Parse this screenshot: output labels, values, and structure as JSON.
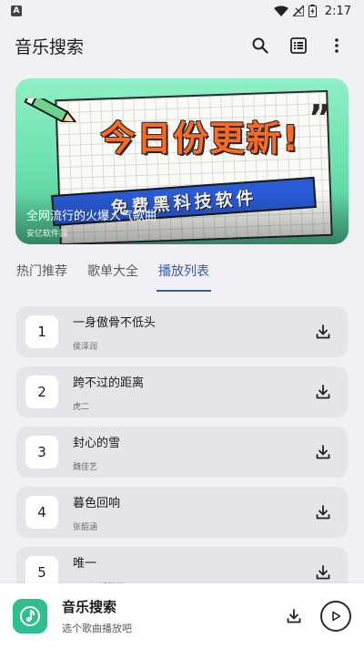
{
  "status_bar": {
    "notif_letter": "A",
    "time": "2:17"
  },
  "app_bar": {
    "title": "音乐搜索",
    "icons": [
      "search-icon",
      "list-icon",
      "more-vert-icon"
    ]
  },
  "banner": {
    "headline": "今日份更新!",
    "ribbon": "免费黑科技软件",
    "title": "全网流行的火爆人气歌曲",
    "source": "安亿软件园"
  },
  "tabs": [
    {
      "label": "热门推荐",
      "active": false
    },
    {
      "label": "歌单大全",
      "active": false
    },
    {
      "label": "播放列表",
      "active": true
    }
  ],
  "songs": [
    {
      "index": "1",
      "title": "一身傲骨不低头",
      "artist": "侯泽润"
    },
    {
      "index": "2",
      "title": "跨不过的距离",
      "artist": "虎二"
    },
    {
      "index": "3",
      "title": "封心的雪",
      "artist": "魏佳艺"
    },
    {
      "index": "4",
      "title": "暮色回响",
      "artist": "张韶涵"
    },
    {
      "index": "5",
      "title": "唯一",
      "artist": "G.E.M.邓紫棋"
    }
  ],
  "player": {
    "title": "音乐搜索",
    "subtitle": "选个歌曲播放吧"
  },
  "colors": {
    "accent": "#3a5aa8",
    "banner_green": "#6ee2b0",
    "logo_green": "#2fbf8f",
    "headline_orange": "#ff6a22",
    "ribbon_blue": "#2a5bd7"
  }
}
